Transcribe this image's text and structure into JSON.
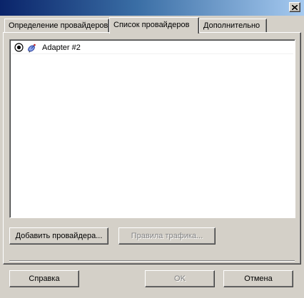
{
  "window": {
    "title": ""
  },
  "tabs": [
    {
      "label": "Определение провайдеров",
      "active": false
    },
    {
      "label": "Список провайдеров",
      "active": true
    },
    {
      "label": "Дополнительно",
      "active": false
    }
  ],
  "providers": [
    {
      "name": "Adapter #2",
      "selected": true,
      "icon": "satellite-dish-icon"
    }
  ],
  "buttons": {
    "add_provider": "Добавить провайдера...",
    "traffic_rules": "Правила трафика...",
    "help": "Справка",
    "ok": "OK",
    "cancel": "Отмена"
  },
  "colors": {
    "title_gradient_start": "#0a246a",
    "title_gradient_end": "#a6caf0",
    "dialog_face": "#d4d0c8",
    "disabled_text": "#808080"
  }
}
